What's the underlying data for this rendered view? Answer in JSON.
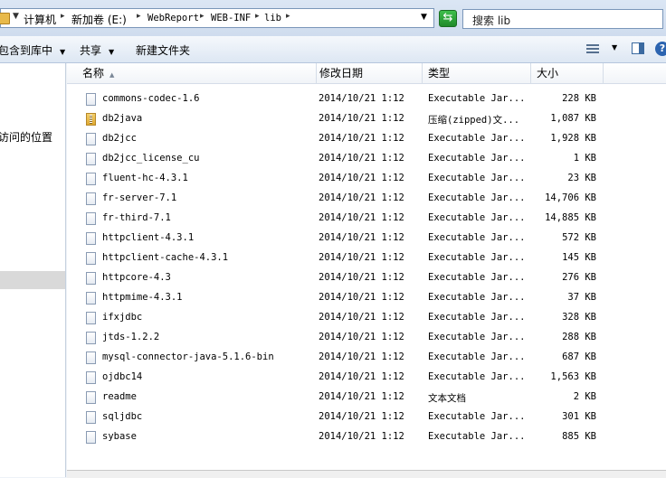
{
  "address": {
    "crumbs": [
      "计算机",
      "新加卷 (E:)",
      "WebReport",
      "WEB-INF",
      "lib"
    ],
    "search_placeholder": "搜索 lib"
  },
  "toolbar": {
    "include_in_library": "包含到库中",
    "share": "共享",
    "new_folder": "新建文件夹"
  },
  "nav": {
    "recent_places": "访问的位置"
  },
  "columns": {
    "name": "名称",
    "modified": "修改日期",
    "type": "类型",
    "size": "大小"
  },
  "files": [
    {
      "name": "commons-codec-1.6",
      "modified": "2014/10/21 1:12",
      "type": "Executable Jar...",
      "size": "228 KB",
      "icon": "jar-file-icon"
    },
    {
      "name": "db2java",
      "modified": "2014/10/21 1:12",
      "type": "压缩(zipped)文...",
      "size": "1,087 KB",
      "icon": "zip-folder-icon"
    },
    {
      "name": "db2jcc",
      "modified": "2014/10/21 1:12",
      "type": "Executable Jar...",
      "size": "1,928 KB",
      "icon": "jar-file-icon"
    },
    {
      "name": "db2jcc_license_cu",
      "modified": "2014/10/21 1:12",
      "type": "Executable Jar...",
      "size": "1 KB",
      "icon": "jar-file-icon"
    },
    {
      "name": "fluent-hc-4.3.1",
      "modified": "2014/10/21 1:12",
      "type": "Executable Jar...",
      "size": "23 KB",
      "icon": "jar-file-icon"
    },
    {
      "name": "fr-server-7.1",
      "modified": "2014/10/21 1:12",
      "type": "Executable Jar...",
      "size": "14,706 KB",
      "icon": "jar-file-icon"
    },
    {
      "name": "fr-third-7.1",
      "modified": "2014/10/21 1:12",
      "type": "Executable Jar...",
      "size": "14,885 KB",
      "icon": "jar-file-icon"
    },
    {
      "name": "httpclient-4.3.1",
      "modified": "2014/10/21 1:12",
      "type": "Executable Jar...",
      "size": "572 KB",
      "icon": "jar-file-icon"
    },
    {
      "name": "httpclient-cache-4.3.1",
      "modified": "2014/10/21 1:12",
      "type": "Executable Jar...",
      "size": "145 KB",
      "icon": "jar-file-icon"
    },
    {
      "name": "httpcore-4.3",
      "modified": "2014/10/21 1:12",
      "type": "Executable Jar...",
      "size": "276 KB",
      "icon": "jar-file-icon"
    },
    {
      "name": "httpmime-4.3.1",
      "modified": "2014/10/21 1:12",
      "type": "Executable Jar...",
      "size": "37 KB",
      "icon": "jar-file-icon"
    },
    {
      "name": "ifxjdbc",
      "modified": "2014/10/21 1:12",
      "type": "Executable Jar...",
      "size": "328 KB",
      "icon": "jar-file-icon"
    },
    {
      "name": "jtds-1.2.2",
      "modified": "2014/10/21 1:12",
      "type": "Executable Jar...",
      "size": "288 KB",
      "icon": "jar-file-icon"
    },
    {
      "name": "mysql-connector-java-5.1.6-bin",
      "modified": "2014/10/21 1:12",
      "type": "Executable Jar...",
      "size": "687 KB",
      "icon": "jar-file-icon"
    },
    {
      "name": "ojdbc14",
      "modified": "2014/10/21 1:12",
      "type": "Executable Jar...",
      "size": "1,563 KB",
      "icon": "jar-file-icon"
    },
    {
      "name": "readme",
      "modified": "2014/10/21 1:12",
      "type": "文本文档",
      "size": "2 KB",
      "icon": "text-file-icon"
    },
    {
      "name": "sqljdbc",
      "modified": "2014/10/21 1:12",
      "type": "Executable Jar...",
      "size": "301 KB",
      "icon": "jar-file-icon"
    },
    {
      "name": "sybase",
      "modified": "2014/10/21 1:12",
      "type": "Executable Jar...",
      "size": "885 KB",
      "icon": "jar-file-icon"
    }
  ]
}
